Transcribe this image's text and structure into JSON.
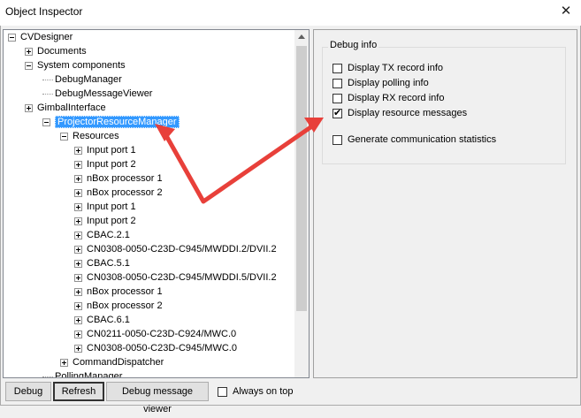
{
  "window": {
    "title": "Object Inspector",
    "close_glyph": "✕"
  },
  "tree": {
    "rows": [
      {
        "label": "CVDesigner",
        "expander": "minus"
      },
      {
        "label": "Documents",
        "expander": "plus"
      },
      {
        "label": "System components",
        "expander": "minus"
      },
      {
        "label": "DebugManager",
        "expander": "none"
      },
      {
        "label": "DebugMessageViewer",
        "expander": "none"
      },
      {
        "label": "GimbalInterface",
        "expander": "plus"
      },
      {
        "label": "ProjectorResourceManager",
        "expander": "minus",
        "selected": true
      },
      {
        "label": "Resources",
        "expander": "minus"
      },
      {
        "label": "Input port 1",
        "expander": "plus"
      },
      {
        "label": "Input port 2",
        "expander": "plus"
      },
      {
        "label": "nBox processor 1",
        "expander": "plus"
      },
      {
        "label": "nBox processor 2",
        "expander": "plus"
      },
      {
        "label": "Input port 1",
        "expander": "plus"
      },
      {
        "label": "Input port 2",
        "expander": "plus"
      },
      {
        "label": "CBAC.2.1",
        "expander": "plus"
      },
      {
        "label": "CN0308-0050-C23D-C945/MWDDI.2/DVII.2",
        "expander": "plus"
      },
      {
        "label": "CBAC.5.1",
        "expander": "plus"
      },
      {
        "label": "CN0308-0050-C23D-C945/MWDDI.5/DVII.2",
        "expander": "plus"
      },
      {
        "label": "nBox processor 1",
        "expander": "plus"
      },
      {
        "label": "nBox processor 2",
        "expander": "plus"
      },
      {
        "label": "CBAC.6.1",
        "expander": "plus"
      },
      {
        "label": "CN0211-0050-C23D-C924/MWC.0",
        "expander": "plus"
      },
      {
        "label": "CN0308-0050-C23D-C945/MWC.0",
        "expander": "plus"
      },
      {
        "label": "CommandDispatcher",
        "expander": "plus"
      },
      {
        "label": "PollingManager",
        "expander": "none"
      }
    ]
  },
  "debug_info": {
    "group_label": "Debug info",
    "options": [
      {
        "label": "Display TX record info",
        "checked": false
      },
      {
        "label": "Display polling info",
        "checked": false
      },
      {
        "label": "Display RX record info",
        "checked": false
      },
      {
        "label": "Display resource messages",
        "checked": true
      },
      {
        "label": "Generate communication statistics",
        "checked": false
      }
    ]
  },
  "bottom_bar": {
    "debug_label": "Debug",
    "refresh_label": "Refresh",
    "viewer_label": "Debug message viewer",
    "always_on_top_label": "Always on top",
    "always_on_top_checked": false
  },
  "annotation": {
    "arrow_color": "#e8403a"
  }
}
